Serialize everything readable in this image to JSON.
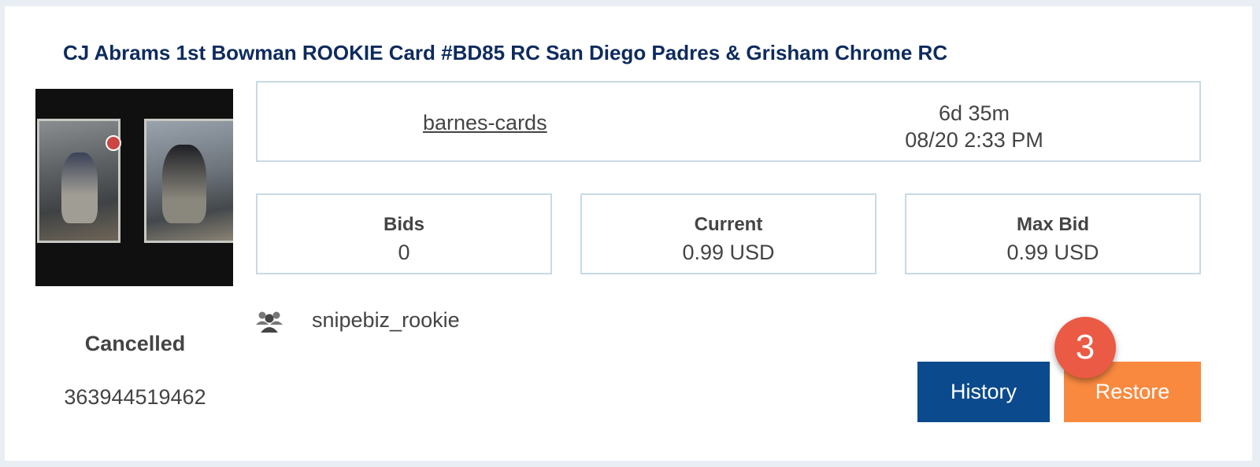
{
  "listing": {
    "title": "CJ Abrams 1st Bowman ROOKIE Card #BD85 RC San Diego Padres & Grisham Chrome RC",
    "seller": "barnes-cards",
    "time_left": "6d 35m",
    "end_time": "08/20 2:33 PM",
    "stats": [
      {
        "label": "Bids",
        "value": "0"
      },
      {
        "label": "Current",
        "value": "0.99 USD"
      },
      {
        "label": "Max Bid",
        "value": "0.99 USD"
      }
    ],
    "user": "snipebiz_rookie",
    "status": "Cancelled",
    "item_id": "363944519462"
  },
  "actions": {
    "history_label": "History",
    "restore_label": "Restore",
    "step_badge": "3"
  },
  "colors": {
    "title": "#0e2b5e",
    "history_button": "#0b4a8c",
    "restore_button": "#f9893f",
    "badge": "#eb5a44",
    "box_border": "#c8d9e6"
  },
  "icons": {
    "group": "group-icon"
  }
}
